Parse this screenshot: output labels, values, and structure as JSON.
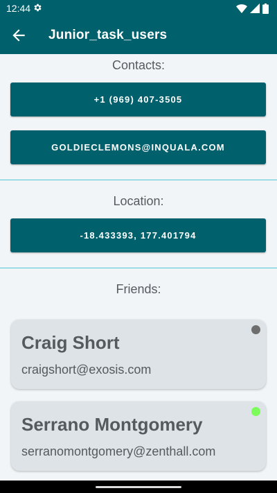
{
  "status_bar": {
    "time": "12:44",
    "icons": [
      "gear-icon",
      "wifi-icon",
      "signal-icon",
      "battery-icon"
    ]
  },
  "app_bar": {
    "title": "Junior_task_users",
    "back_icon": "arrow-left-icon"
  },
  "contacts": {
    "label": "Contacts:",
    "phone": "+1 (969) 407-3505",
    "email": "GOLDIECLEMONS@INQUALA.COM"
  },
  "location": {
    "label": "Location:",
    "coordinates": "-18.433393, 177.401794"
  },
  "friends": {
    "label": "Friends:",
    "items": [
      {
        "name": "Craig Short",
        "email": "craigshort@exosis.com",
        "online": false
      },
      {
        "name": "Serrano Montgomery",
        "email": "serranomontgomery@zenthall.com",
        "online": true
      }
    ]
  },
  "colors": {
    "primary": "#00606C",
    "divider": "#4FC6D5",
    "card": "#DDE3E6",
    "offline": "#6E6E6E",
    "online": "#7CFC5A"
  }
}
